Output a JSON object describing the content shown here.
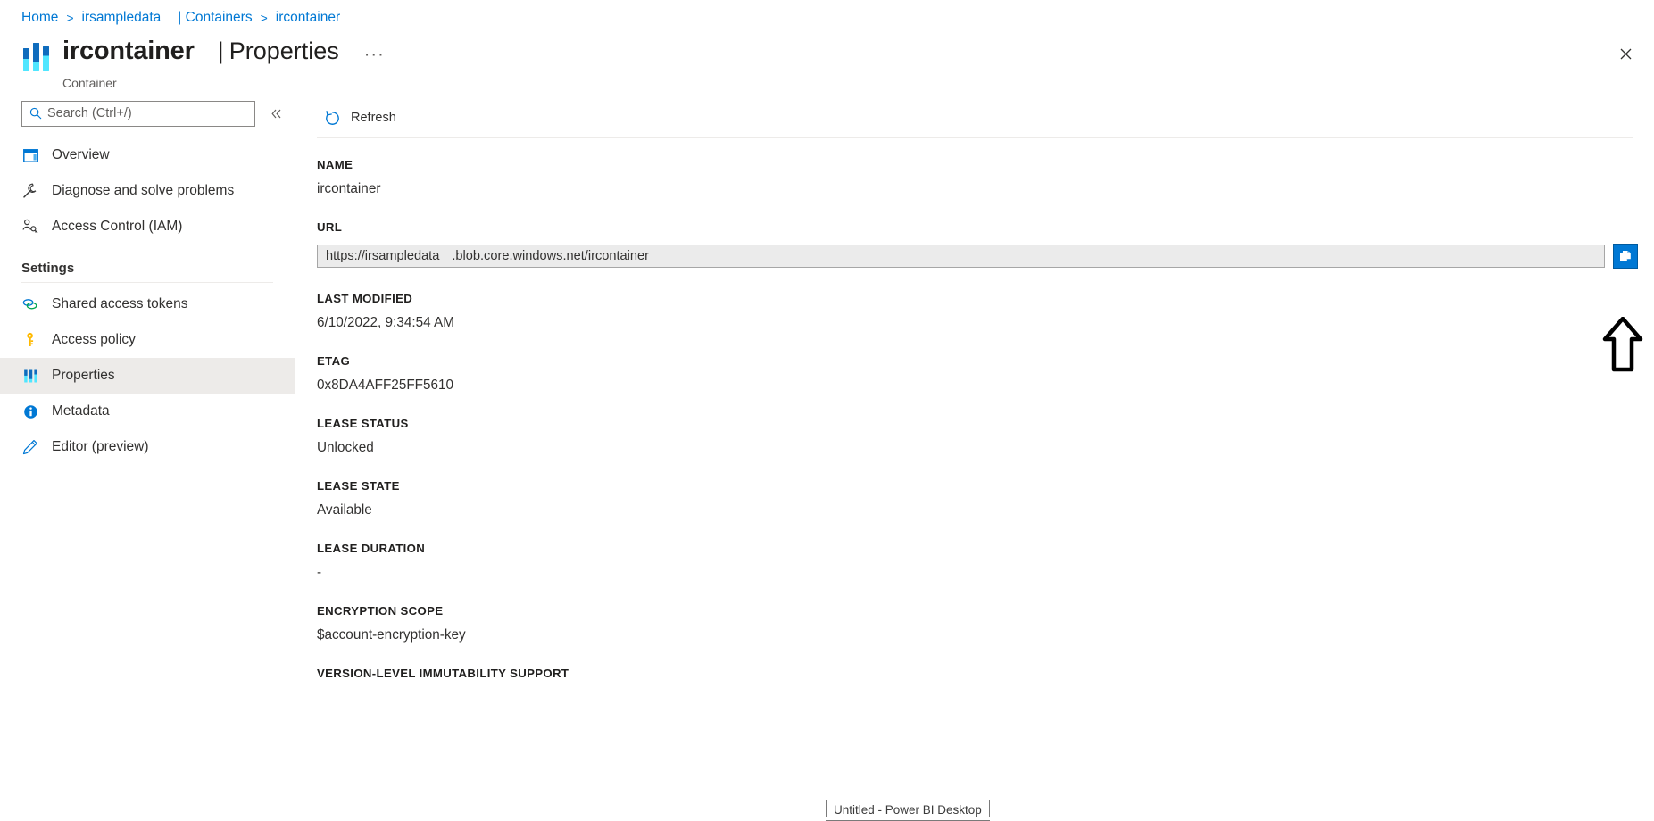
{
  "breadcrumb": {
    "items": [
      {
        "label": "Home"
      },
      {
        "label": "irsampledata"
      },
      {
        "label": "| Containers"
      },
      {
        "label": "ircontainer"
      }
    ],
    "separator": ">"
  },
  "header": {
    "resource_name": "ircontainer",
    "pipe": "|",
    "section": "Properties",
    "ellipsis": "···",
    "subtitle": "Container",
    "close_label": "✕",
    "icon": "container-bars-icon"
  },
  "sidebar": {
    "search": {
      "placeholder": "Search (Ctrl+/)",
      "value": "",
      "icon": "search-icon"
    },
    "collapse": {
      "label": "«",
      "icon": "chevron-double-left-icon"
    },
    "top_items": [
      {
        "label": "Overview",
        "icon": "overview-window-icon",
        "selected": false
      },
      {
        "label": "Diagnose and solve problems",
        "icon": "wrench-icon",
        "selected": false
      },
      {
        "label": "Access Control (IAM)",
        "icon": "person-key-icon",
        "selected": false
      }
    ],
    "settings_group": {
      "title": "Settings",
      "items": [
        {
          "label": "Shared access tokens",
          "icon": "link-chain-icon",
          "selected": false
        },
        {
          "label": "Access policy",
          "icon": "key-icon",
          "selected": false
        },
        {
          "label": "Properties",
          "icon": "properties-bars-icon",
          "selected": true
        },
        {
          "label": "Metadata",
          "icon": "info-circle-icon",
          "selected": false
        },
        {
          "label": "Editor (preview)",
          "icon": "pencil-icon",
          "selected": false
        }
      ]
    }
  },
  "command_bar": {
    "refresh": {
      "label": "Refresh",
      "icon": "refresh-icon"
    }
  },
  "properties": {
    "name": {
      "label": "NAME",
      "value": "ircontainer"
    },
    "url": {
      "label": "URL",
      "value_prefix": "https://irsampledata",
      "value_suffix": ".blob.core.windows.net/ircontainer",
      "copy_icon": "copy-to-clipboard-icon",
      "copy_title": "Copy to clipboard"
    },
    "last_modified": {
      "label": "LAST MODIFIED",
      "value": "6/10/2022, 9:34:54 AM"
    },
    "etag": {
      "label": "ETAG",
      "value": "0x8DA4AFF25FF5610"
    },
    "lease_status": {
      "label": "LEASE STATUS",
      "value": "Unlocked"
    },
    "lease_state": {
      "label": "LEASE STATE",
      "value": "Available"
    },
    "lease_duration": {
      "label": "LEASE DURATION",
      "value": "-"
    },
    "encryption_scope": {
      "label": "ENCRYPTION SCOPE",
      "value": "$account-encryption-key"
    },
    "version_immutability": {
      "label": "VERSION-LEVEL IMMUTABILITY SUPPORT"
    }
  },
  "annotation": {
    "arrow": "up-arrow-annotation",
    "color": "#000000"
  },
  "taskbar": {
    "tooltip": "Untitled - Power BI Desktop"
  },
  "colors": {
    "accent": "#0078d4",
    "link": "#0078d4",
    "selected_nav_bg": "#edebe9",
    "url_field_bg": "#ebebeb",
    "text": "#323130"
  }
}
